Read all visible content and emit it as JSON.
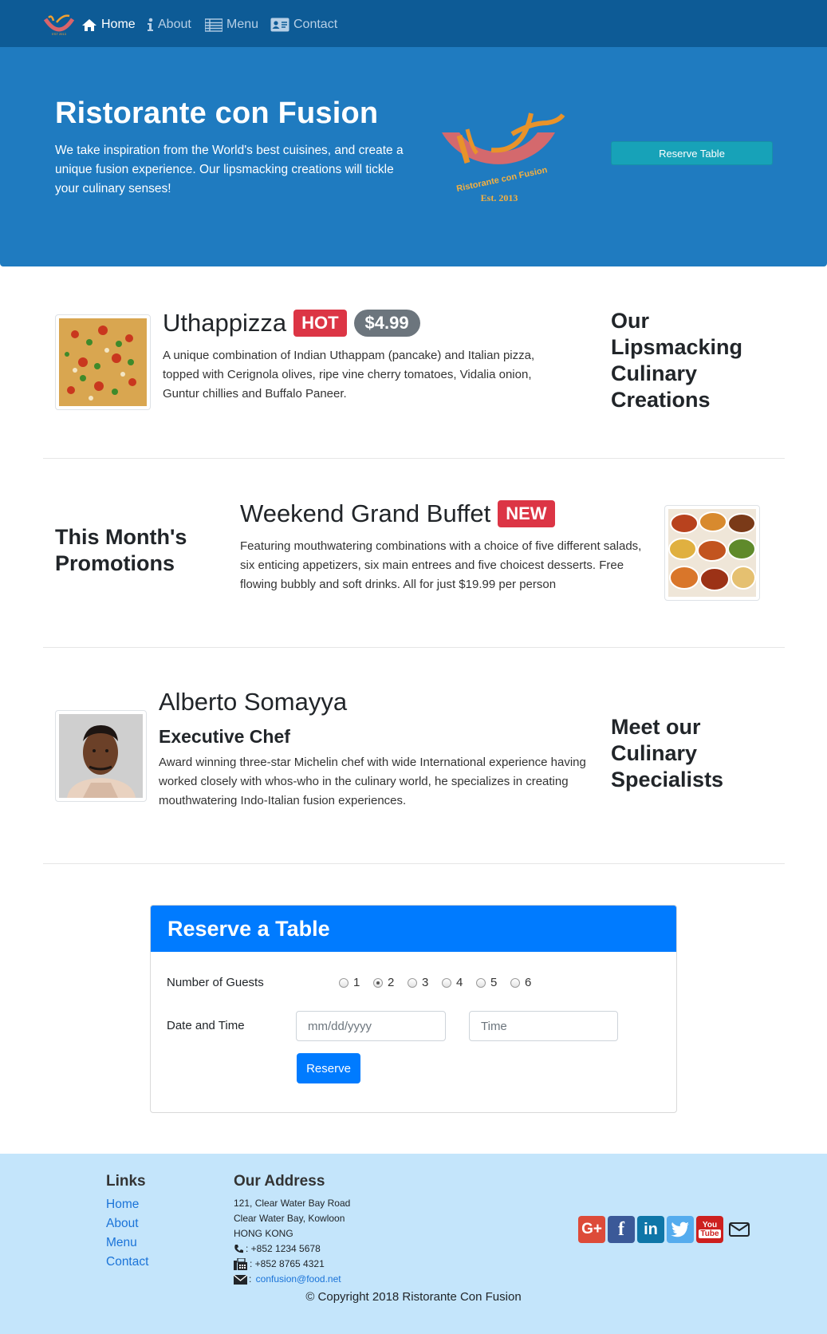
{
  "nav": {
    "brand_icon": "restaurant-logo",
    "items": [
      {
        "label": "Home",
        "icon": "home-icon",
        "active": true
      },
      {
        "label": "About",
        "icon": "info-icon"
      },
      {
        "label": "Menu",
        "icon": "list-icon"
      },
      {
        "label": "Contact",
        "icon": "address-card-icon"
      }
    ]
  },
  "jumbotron": {
    "title": "Ristorante con Fusion",
    "text": "We take inspiration from the World's best cuisines, and create a unique fusion experience. Our lipsmacking creations will tickle your culinary senses!",
    "logo_text": "Ristorante con Fusion",
    "logo_est": "Est. 2013",
    "button": "Reserve Table"
  },
  "dish": {
    "name": "Uthappizza",
    "badge": "HOT",
    "price": "$4.99",
    "description": "A unique combination of Indian Uthappam (pancake) and Italian pizza, topped with Cerignola olives, ripe vine cherry tomatoes, Vidalia onion, Guntur chillies and Buffalo Paneer.",
    "side_heading": "Our Lipsmacking Culinary Creations"
  },
  "promotion": {
    "side_heading": "This Month's Promotions",
    "name": "Weekend Grand Buffet",
    "badge": "NEW",
    "description": "Featuring mouthwatering combinations with a choice of five different salads, six enticing appetizers, six main entrees and five choicest desserts. Free flowing bubbly and soft drinks. All for just $19.99 per person"
  },
  "leader": {
    "name": "Alberto Somayya",
    "designation": "Executive Chef",
    "description": "Award winning three-star Michelin chef with wide International experience having worked closely with whos-who in the culinary world, he specializes in creating mouthwatering Indo-Italian fusion experiences.",
    "side_heading": "Meet our Culinary Specialists"
  },
  "reservation": {
    "title": "Reserve a Table",
    "guests_label": "Number of Guests",
    "guest_options": [
      "1",
      "2",
      "3",
      "4",
      "5",
      "6"
    ],
    "guests_selected": "2",
    "datetime_label": "Date and Time",
    "date_placeholder": "mm/dd/yyyy",
    "time_placeholder": "Time",
    "submit": "Reserve"
  },
  "footer": {
    "links_heading": "Links",
    "links": [
      "Home",
      "About",
      "Menu",
      "Contact"
    ],
    "address_heading": "Our Address",
    "address_lines": [
      "121, Clear Water Bay Road",
      "Clear Water Bay, Kowloon",
      "HONG KONG"
    ],
    "phone": ": +852 1234 5678",
    "fax": ": +852 8765 4321",
    "email": "confusion@food.net",
    "social": [
      "google-plus-icon",
      "facebook-icon",
      "linkedin-icon",
      "twitter-icon",
      "youtube-icon",
      "envelope-icon"
    ],
    "copyright": "© Copyright 2018 Ristorante Con Fusion"
  },
  "colors": {
    "navbar": "#0d5b96",
    "jumbotron": "#1f7bc0",
    "primary": "#007bff",
    "info": "#17a2b8",
    "danger": "#dc3545",
    "footer": "#c4e5fb"
  }
}
